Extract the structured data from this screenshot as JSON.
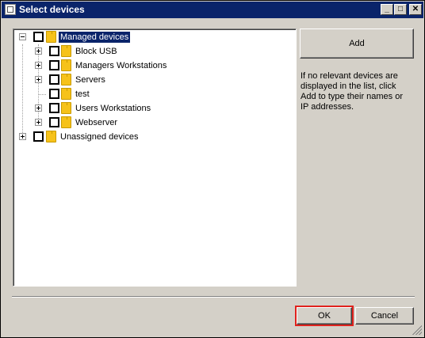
{
  "window": {
    "title": "Select devices"
  },
  "titlebar_buttons": {
    "minimize": "_",
    "maximize": "□",
    "close": "✕"
  },
  "tree": {
    "root": {
      "label": "Managed devices",
      "expanded": true,
      "selected": true
    },
    "children": [
      {
        "label": "Block USB",
        "expandable": true
      },
      {
        "label": "Managers Workstations",
        "expandable": true
      },
      {
        "label": "Servers",
        "expandable": true
      },
      {
        "label": "test",
        "expandable": false
      },
      {
        "label": "Users Workstations",
        "expandable": true
      },
      {
        "label": "Webserver",
        "expandable": true
      }
    ],
    "unassigned": {
      "label": "Unassigned devices",
      "expandable": true
    }
  },
  "add_button": {
    "label": "Add"
  },
  "info_text": "If no relevant devices are displayed in the list, click Add to type their names or IP addresses.",
  "footer": {
    "ok_label": "OK",
    "cancel_label": "Cancel"
  },
  "colors": {
    "title_bar": "#0a246a",
    "selection": "#0a246a",
    "folder": "#f6c21a",
    "highlight_frame": "#e0221d",
    "window_bg": "#d4d0c8"
  },
  "icons": {
    "folder": "folder-icon",
    "app": "app-icon"
  }
}
